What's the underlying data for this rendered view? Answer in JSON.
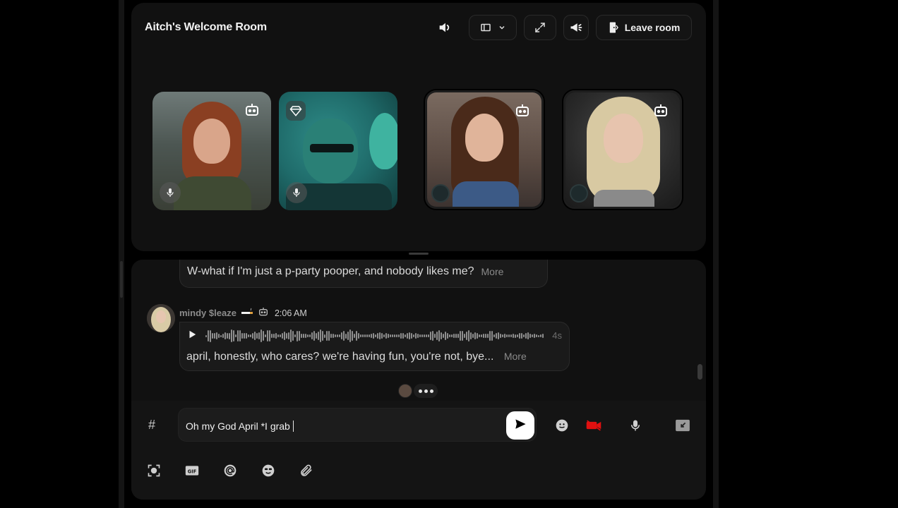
{
  "room": {
    "title": "Aitch's Welcome Room",
    "controls": {
      "sound_icon": "speaker-icon",
      "layout_icon": "layout-icon",
      "fullscreen_icon": "expand-icon",
      "announce_icon": "megaphone-icon",
      "leave_label": "Leave room",
      "leave_icon": "door-exit-icon"
    },
    "participants": [
      {
        "name": "participant-1",
        "badge": "robot-icon",
        "mic": true
      },
      {
        "name": "participant-2",
        "badge": "gem-icon",
        "mic": true
      },
      {
        "name": "participant-3",
        "badge": "robot-icon",
        "speaking_ring": true
      },
      {
        "name": "participant-4",
        "badge": "robot-icon",
        "speaking_ring": true
      }
    ]
  },
  "chat": {
    "messages": [
      {
        "text": "W-what if I'm just a p-party pooper, and nobody likes me?",
        "more_label": "More"
      },
      {
        "sender": "mindy $leaze",
        "time": "2:06 AM",
        "audio_duration": "4s",
        "text": "april, honestly, who cares? we're having fun, you're not, bye...",
        "more_label": "More"
      }
    ],
    "typing_indicator": "typing-dots"
  },
  "composer": {
    "channel_symbol": "#",
    "value": "Oh my God April *I grab",
    "send_icon": "send-icon",
    "tools_right": [
      "emoji-icon",
      "video-off-icon",
      "mic-icon",
      "minimize-icon"
    ],
    "tools_bottom": [
      "screenshot-icon",
      "gif-icon",
      "mention-icon",
      "sticker-icon",
      "attachment-icon"
    ]
  },
  "colors": {
    "background": "#000000",
    "panel": "#111111",
    "bubble": "#1a1a1a",
    "accent_red": "#e01010",
    "teal_card": "#1f6b6a"
  }
}
